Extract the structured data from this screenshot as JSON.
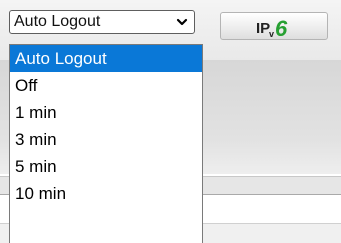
{
  "colors": {
    "selection": "#0a78d7",
    "badge_green": "#27a032"
  },
  "logout_select": {
    "value": "Auto Logout",
    "icon": "chevron-down-icon"
  },
  "dropdown": {
    "options": [
      "Auto Logout",
      "Off",
      "1 min",
      "3 min",
      "5 min",
      "10 min"
    ],
    "highlighted": "Auto Logout"
  },
  "ipv6_badge": {
    "text_prefix": "IP",
    "text_sub": "v",
    "text_number": "6"
  }
}
